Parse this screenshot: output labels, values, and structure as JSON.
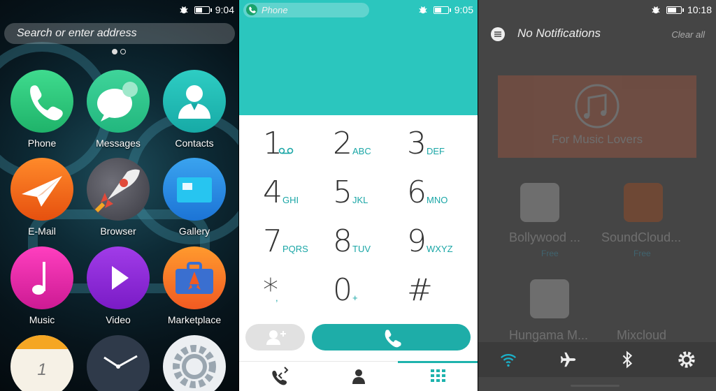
{
  "homescreen": {
    "status": {
      "time": "9:04",
      "battery_level": 0.55
    },
    "search": {
      "placeholder": "Search or enter address"
    },
    "pages": 2,
    "apps": [
      {
        "label": "Phone",
        "icon": "phone-icon"
      },
      {
        "label": "Messages",
        "icon": "messages-icon"
      },
      {
        "label": "Contacts",
        "icon": "contacts-icon"
      },
      {
        "label": "E-Mail",
        "icon": "email-icon"
      },
      {
        "label": "Browser",
        "icon": "browser-rocket-icon"
      },
      {
        "label": "Gallery",
        "icon": "gallery-icon"
      },
      {
        "label": "Music",
        "icon": "music-icon"
      },
      {
        "label": "Video",
        "icon": "video-icon"
      },
      {
        "label": "Marketplace",
        "icon": "marketplace-icon"
      },
      {
        "label": "",
        "icon": "calendar-icon",
        "value": "1"
      },
      {
        "label": "",
        "icon": "clock-icon"
      },
      {
        "label": "",
        "icon": "settings-icon"
      }
    ]
  },
  "dialer": {
    "status": {
      "time": "9:05",
      "battery_level": 0.55
    },
    "notification_pill": "Phone",
    "keys": [
      {
        "digit": "1",
        "letters": ""
      },
      {
        "digit": "2",
        "letters": "ABC"
      },
      {
        "digit": "3",
        "letters": "DEF"
      },
      {
        "digit": "4",
        "letters": "GHI"
      },
      {
        "digit": "5",
        "letters": "JKL"
      },
      {
        "digit": "6",
        "letters": "MNO"
      },
      {
        "digit": "7",
        "letters": "PQRS"
      },
      {
        "digit": "8",
        "letters": "TUV"
      },
      {
        "digit": "9",
        "letters": "WXYZ"
      },
      {
        "digit": "*",
        "letters": ","
      },
      {
        "digit": "0",
        "letters": "+"
      },
      {
        "digit": "#",
        "letters": ""
      }
    ],
    "tabs": [
      "call-log-icon",
      "contacts-tab-icon",
      "keypad-icon"
    ],
    "active_tab": 2
  },
  "notifications": {
    "status": {
      "time": "10:18",
      "battery_level": 0.7
    },
    "title": "No Notifications",
    "clear_all": "Clear all",
    "background_app": {
      "banner_text": "For Music Lovers",
      "apps": [
        {
          "name": "Bollywood ...",
          "price": "Free"
        },
        {
          "name": "SoundCloud...",
          "price": "Free"
        },
        {
          "name": "Hungama M...",
          "price": ""
        },
        {
          "name": "Mixcloud",
          "price": ""
        }
      ]
    },
    "quick_settings": [
      "wifi-icon",
      "airplane-mode-icon",
      "bluetooth-icon",
      "settings-icon"
    ],
    "colors": {
      "wifi_active": "#1bb0c8"
    }
  }
}
